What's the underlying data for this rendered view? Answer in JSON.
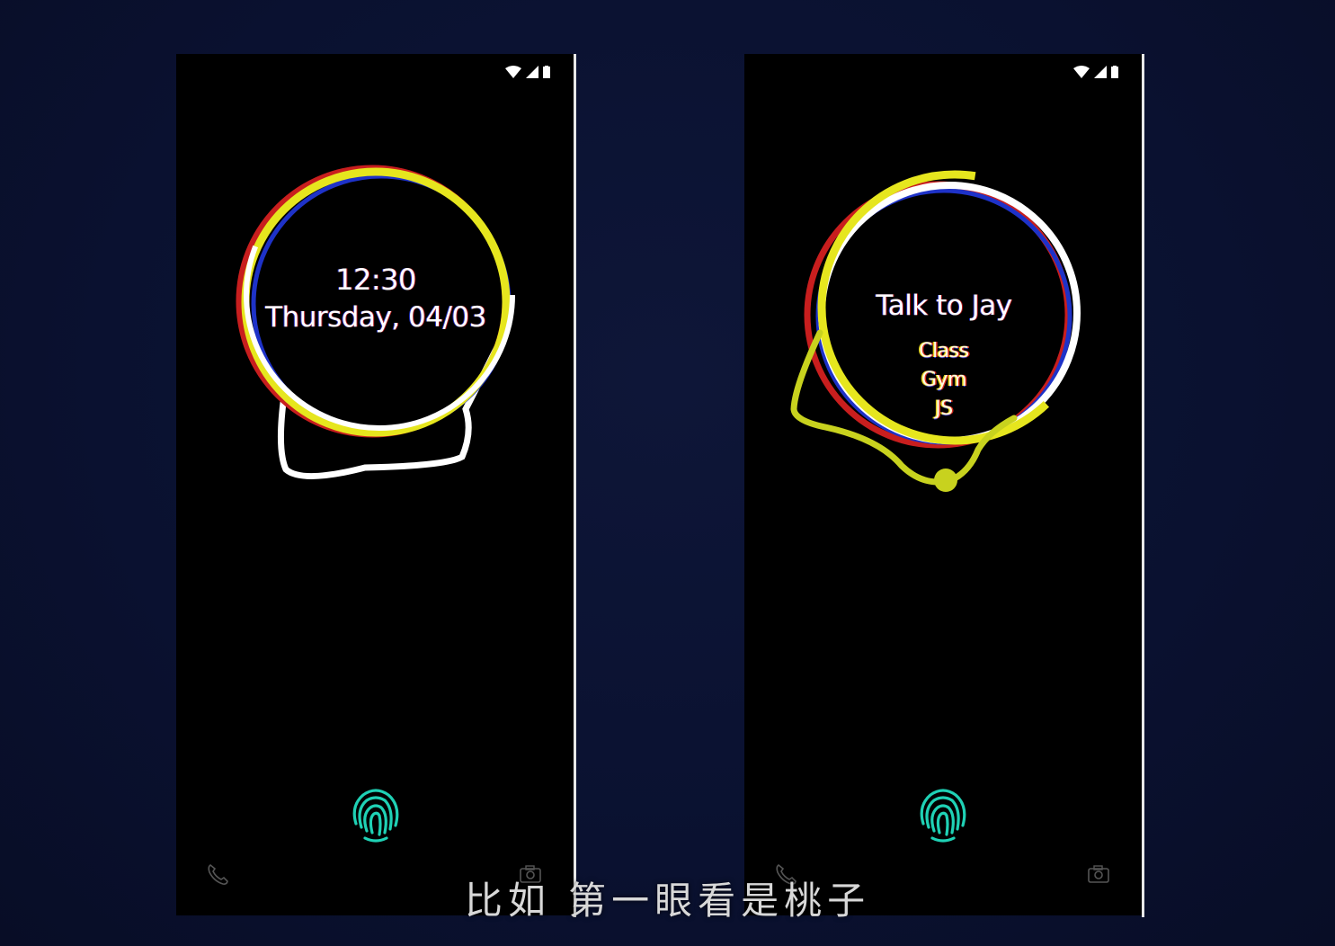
{
  "colors": {
    "background": "#0a1130",
    "phone_screen": "#000000",
    "ring_yellow": "#e6e61e",
    "ring_white": "#ffffff",
    "ring_red": "#c81e1e",
    "ring_blue": "#1e32c8",
    "tail_lime": "#c8d21e",
    "fingerprint": "#1fd1b5",
    "subtitle": "#d8d8d8"
  },
  "left_phone": {
    "status_icons": [
      "wifi-icon",
      "signal-icon",
      "battery-icon"
    ],
    "ambient_display": {
      "time": "12:30",
      "date": "Thursday, 04/03"
    },
    "fingerprint_icon": "fingerprint-icon",
    "bottom_left_icon": "phone-icon",
    "bottom_right_icon": "camera-icon"
  },
  "right_phone": {
    "status_icons": [
      "wifi-icon",
      "signal-icon",
      "battery-icon"
    ],
    "ambient_display": {
      "title": "Talk to Jay",
      "items": [
        "Class",
        "Gym",
        "JS"
      ]
    },
    "fingerprint_icon": "fingerprint-icon",
    "bottom_left_icon": "phone-icon",
    "bottom_right_icon": "camera-icon"
  },
  "subtitle": "比如 第一眼看是桃子"
}
